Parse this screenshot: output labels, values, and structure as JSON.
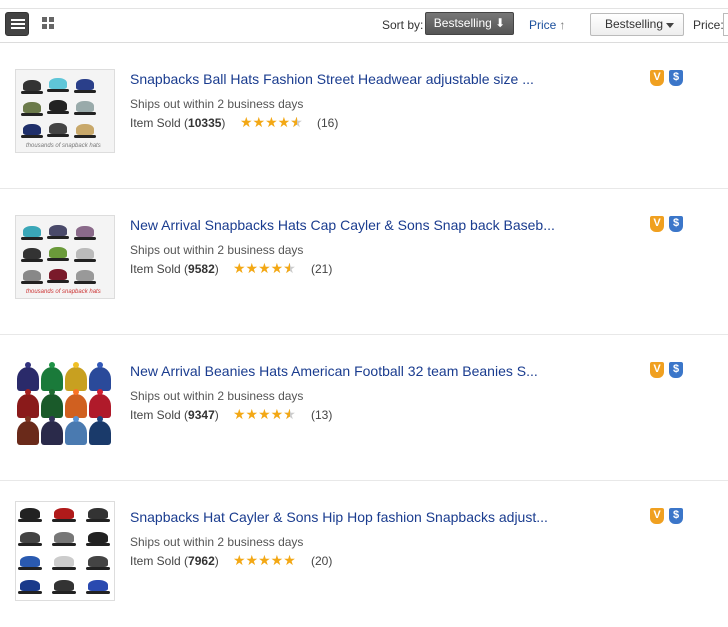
{
  "toolbar": {
    "sort_by_label": "Sort by:",
    "bestselling_button": "Bestselling ⬇",
    "price_label": "Price",
    "price_arrow": "🡑",
    "select_value": "Bestselling",
    "price_filter_label": "Price:",
    "view_list_icon": "list-view-icon",
    "view_grid_icon": "grid-view-icon"
  },
  "products": [
    {
      "title": "Snapbacks Ball Hats Fashion Street Headwear adjustable size ...",
      "shipping": "Ships out within 2 business days",
      "sold_label": "Item Sold",
      "sold_count": "10335",
      "rating": 4.5,
      "reviews": "(16)",
      "thumb_caption": "thousands of snapback hats"
    },
    {
      "title": "New Arrival Snapbacks Hats Cap Cayler & Sons Snap back Baseb...",
      "shipping": "Ships out within 2 business days",
      "sold_label": "Item Sold",
      "sold_count": "9582",
      "rating": 4.5,
      "reviews": "(21)",
      "thumb_caption": "thousands of snapback hats"
    },
    {
      "title": "New Arrival Beanies Hats American Football 32 team Beanies S...",
      "shipping": "Ships out within 2 business days",
      "sold_label": "Item Sold",
      "sold_count": "9347",
      "rating": 4.5,
      "reviews": "(13)",
      "thumb_caption": ""
    },
    {
      "title": "Snapbacks Hat Cayler & Sons Hip Hop fashion Snapbacks adjust...",
      "shipping": "Ships out within 2 business days",
      "sold_label": "Item Sold",
      "sold_count": "7962",
      "rating": 5,
      "reviews": "(20)",
      "thumb_caption": ""
    }
  ],
  "badges": {
    "verified": "V",
    "secure": "$"
  },
  "colors": {
    "title_link": "#1a3c8f",
    "star": "#f3a815",
    "badge_orange": "#f0a020",
    "badge_blue": "#3b76c9"
  }
}
